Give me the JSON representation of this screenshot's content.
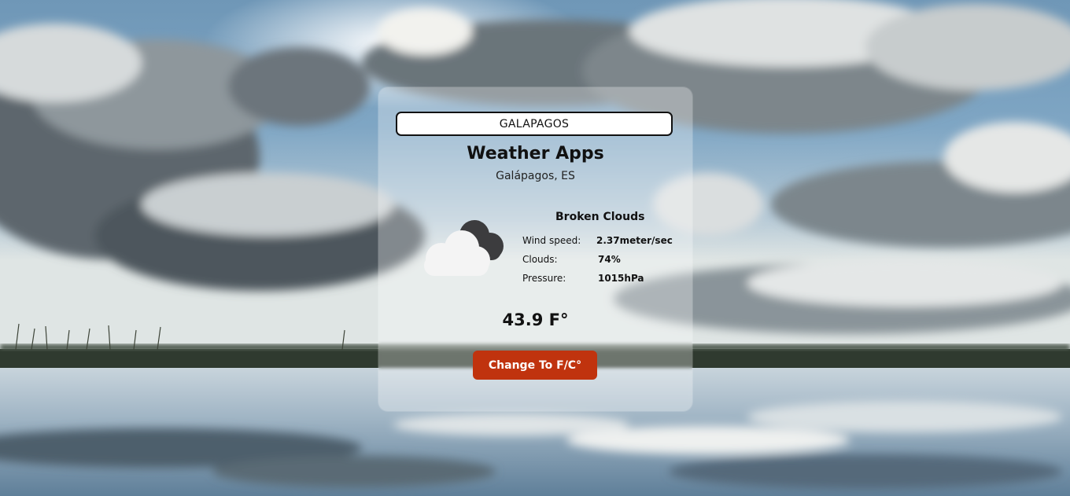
{
  "colors": {
    "card_bg": "rgba(255,255,255,0.30)",
    "button_bg": "#c0330e",
    "text": "#111111"
  },
  "search": {
    "value": "GALAPAGOS"
  },
  "app": {
    "title": "Weather Apps",
    "location": "Galápagos, ES"
  },
  "weather": {
    "icon": "broken-clouds-icon",
    "description": "Broken Clouds",
    "stats": [
      {
        "label": "Wind speed:",
        "value": "2.37meter/sec"
      },
      {
        "label": "Clouds:",
        "value": "74%"
      },
      {
        "label": "Pressure:",
        "value": "1015hPa"
      }
    ],
    "temperature": "43.9 F°"
  },
  "toggle_button": {
    "label": "Change To F/C°"
  }
}
